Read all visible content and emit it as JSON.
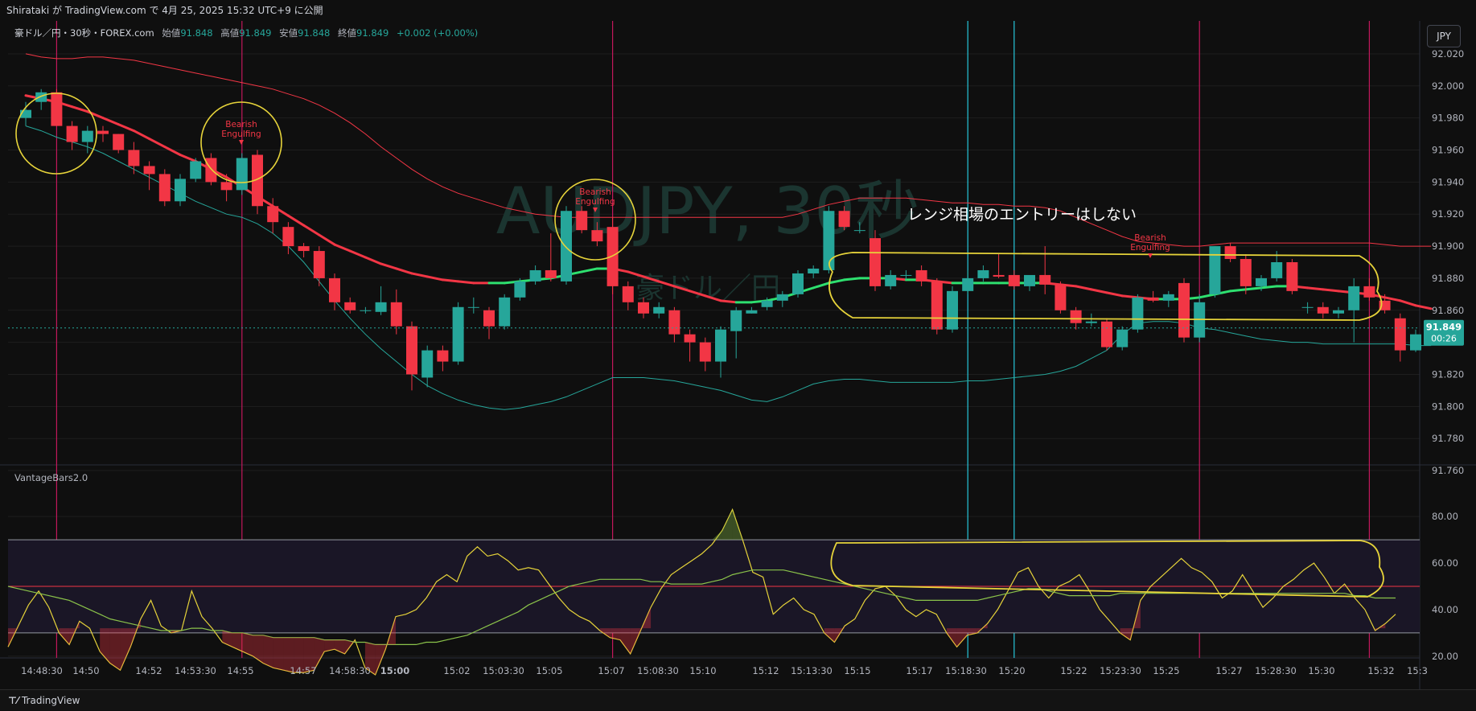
{
  "header": {
    "publish_text": "Shirataki が TradingView.com で 4月 25, 2025 15:32 UTC+9 に公開"
  },
  "legend": {
    "symbol": "豪ドル／円・30秒・FOREX.com",
    "open_label": "始値",
    "open": "91.848",
    "high_label": "高値",
    "high": "91.849",
    "low_label": "安値",
    "low": "91.848",
    "close_label": "終値",
    "close": "91.849",
    "change": "+0.002 (+0.00%)"
  },
  "currency_button": "JPY",
  "watermark": {
    "line1": "AUDJPY, 30秒",
    "line2": "豪ドル／円"
  },
  "annotations": {
    "range_note": "レンジ相場のエントリーはしない",
    "pattern_label_1": "Bearish",
    "pattern_label_2": "Engulfing"
  },
  "price_badge": {
    "price": "91.849",
    "countdown": "00:26"
  },
  "indicator_name": "VantageBars2.0",
  "footer": {
    "brand": "TradingView"
  },
  "colors": {
    "bull": "#26a69a",
    "bear": "#f23645",
    "ma": "#f23645",
    "ma_bull": "#2ee06f",
    "upper_band": "#f23645",
    "lower_band": "#26a69a",
    "vline_red": "#c2185b",
    "vline_cyan": "#26c6da",
    "osc": "#e6d33a",
    "osc_signal": "#8bc34a",
    "circle": "#e6d33a"
  },
  "chart_data": [
    {
      "type": "candlestick",
      "title": "AUDJPY, 30秒",
      "y_axis_ticks": [
        "92.020",
        "92.000",
        "91.980",
        "91.960",
        "91.940",
        "91.920",
        "91.900",
        "91.880",
        "91.860",
        "91.840",
        "91.820",
        "91.800",
        "91.780",
        "91.760"
      ],
      "ylim": [
        91.754,
        92.027
      ],
      "x_axis_ticks": [
        "14:48:30",
        "14:50",
        "14:52",
        "14:53:30",
        "14:55",
        "14:57",
        "14:58:30",
        "15:00",
        "15:02",
        "15:03:30",
        "15:05",
        "15:07",
        "15:08:30",
        "15:10",
        "15:12",
        "15:13:30",
        "15:15",
        "15:17",
        "15:18:30",
        "15:20",
        "15:22",
        "15:23:30",
        "15:25",
        "15:27",
        "15:28:30",
        "15:30",
        "15:32",
        "15:3"
      ],
      "candles": [
        [
          91.98,
          91.99,
          91.975,
          91.985
        ],
        [
          91.99,
          91.998,
          91.985,
          91.996
        ],
        [
          91.996,
          91.998,
          91.975,
          91.975
        ],
        [
          91.975,
          91.978,
          91.96,
          91.965
        ],
        [
          91.965,
          91.975,
          91.958,
          91.972
        ],
        [
          91.972,
          91.975,
          91.965,
          91.97
        ],
        [
          91.97,
          91.97,
          91.958,
          91.96
        ],
        [
          91.96,
          91.965,
          91.945,
          91.95
        ],
        [
          91.95,
          91.953,
          91.935,
          91.945
        ],
        [
          91.945,
          91.948,
          91.925,
          91.928
        ],
        [
          91.928,
          91.945,
          91.925,
          91.942
        ],
        [
          91.942,
          91.955,
          91.94,
          91.953
        ],
        [
          91.955,
          91.958,
          91.938,
          91.94
        ],
        [
          91.94,
          91.945,
          91.928,
          91.935
        ],
        [
          91.935,
          91.958,
          91.932,
          91.955
        ],
        [
          91.957,
          91.96,
          91.92,
          91.925
        ],
        [
          91.925,
          91.93,
          91.908,
          91.915
        ],
        [
          91.912,
          91.915,
          91.895,
          91.9
        ],
        [
          91.9,
          91.902,
          91.893,
          91.897
        ],
        [
          91.897,
          91.9,
          91.875,
          91.88
        ],
        [
          91.88,
          91.883,
          91.86,
          91.865
        ],
        [
          91.865,
          91.868,
          91.858,
          91.86
        ],
        [
          91.86,
          91.862,
          91.858,
          91.86
        ],
        [
          91.859,
          91.875,
          91.857,
          91.865
        ],
        [
          91.865,
          91.873,
          91.845,
          91.85
        ],
        [
          91.85,
          91.853,
          91.81,
          91.82
        ],
        [
          91.818,
          91.838,
          91.812,
          91.835
        ],
        [
          91.835,
          91.838,
          91.822,
          91.828
        ],
        [
          91.828,
          91.865,
          91.826,
          91.862
        ],
        [
          91.862,
          91.868,
          91.858,
          91.862
        ],
        [
          91.86,
          91.862,
          91.842,
          91.85
        ],
        [
          91.85,
          91.87,
          91.848,
          91.868
        ],
        [
          91.868,
          91.88,
          91.866,
          91.878
        ],
        [
          91.878,
          91.888,
          91.876,
          91.885
        ],
        [
          91.885,
          91.908,
          91.878,
          91.88
        ],
        [
          91.878,
          91.925,
          91.876,
          91.922
        ],
        [
          91.922,
          91.925,
          91.908,
          91.91
        ],
        [
          91.91,
          91.915,
          91.9,
          91.903
        ],
        [
          91.912,
          91.918,
          91.87,
          91.875
        ],
        [
          91.875,
          91.878,
          91.86,
          91.865
        ],
        [
          91.865,
          91.868,
          91.855,
          91.858
        ],
        [
          91.858,
          91.865,
          91.855,
          91.862
        ],
        [
          91.86,
          91.862,
          91.84,
          91.845
        ],
        [
          91.845,
          91.848,
          91.828,
          91.84
        ],
        [
          91.84,
          91.843,
          91.822,
          91.828
        ],
        [
          91.828,
          91.85,
          91.818,
          91.848
        ],
        [
          91.847,
          91.862,
          91.83,
          91.86
        ],
        [
          91.858,
          91.862,
          91.858,
          91.86
        ],
        [
          91.862,
          91.868,
          91.86,
          91.866
        ],
        [
          91.866,
          91.872,
          91.862,
          91.87
        ],
        [
          91.87,
          91.885,
          91.868,
          91.883
        ],
        [
          91.883,
          91.888,
          91.88,
          91.886
        ],
        [
          91.885,
          91.925,
          91.883,
          91.922
        ],
        [
          91.922,
          91.925,
          91.91,
          91.912
        ],
        [
          91.91,
          91.915,
          91.908,
          91.91
        ],
        [
          91.905,
          91.91,
          91.872,
          91.875
        ],
        [
          91.875,
          91.885,
          91.873,
          91.882
        ],
        [
          91.882,
          91.885,
          91.879,
          91.882
        ],
        [
          91.885,
          91.888,
          91.875,
          91.878
        ],
        [
          91.878,
          91.88,
          91.845,
          91.848
        ],
        [
          91.848,
          91.875,
          91.846,
          91.872
        ],
        [
          91.872,
          91.885,
          91.87,
          91.88
        ],
        [
          91.88,
          91.888,
          91.878,
          91.885
        ],
        [
          91.882,
          91.895,
          91.88,
          91.881
        ],
        [
          91.882,
          91.885,
          91.873,
          91.875
        ],
        [
          91.875,
          91.88,
          91.872,
          91.882
        ],
        [
          91.882,
          91.9,
          91.87,
          91.876
        ],
        [
          91.876,
          91.878,
          91.858,
          91.86
        ],
        [
          91.86,
          91.862,
          91.848,
          91.852
        ],
        [
          91.852,
          91.858,
          91.85,
          91.853
        ],
        [
          91.853,
          91.855,
          91.835,
          91.837
        ],
        [
          91.837,
          91.85,
          91.835,
          91.848
        ],
        [
          91.848,
          91.87,
          91.846,
          91.868
        ],
        [
          91.868,
          91.872,
          91.865,
          91.866
        ],
        [
          91.866,
          91.872,
          91.862,
          91.87
        ],
        [
          91.877,
          91.88,
          91.84,
          91.843
        ],
        [
          91.843,
          91.87,
          91.84,
          91.865
        ],
        [
          91.87,
          91.9,
          91.868,
          91.9
        ],
        [
          91.9,
          91.902,
          91.89,
          91.892
        ],
        [
          91.892,
          91.895,
          91.87,
          91.875
        ],
        [
          91.875,
          91.882,
          91.872,
          91.88
        ],
        [
          91.88,
          91.897,
          91.878,
          91.89
        ],
        [
          91.89,
          91.892,
          91.87,
          91.872
        ],
        [
          91.862,
          91.865,
          91.858,
          91.862
        ],
        [
          91.862,
          91.865,
          91.855,
          91.858
        ],
        [
          91.858,
          91.862,
          91.855,
          91.86
        ],
        [
          91.86,
          91.88,
          91.84,
          91.875
        ],
        [
          91.875,
          91.88,
          91.866,
          91.868
        ],
        [
          91.866,
          91.87,
          91.858,
          91.86
        ],
        [
          91.855,
          91.858,
          91.828,
          91.835
        ],
        [
          91.835,
          91.848,
          91.834,
          91.845
        ]
      ],
      "ma": [
        91.994,
        91.992,
        91.99,
        91.987,
        91.984,
        91.98,
        91.976,
        91.972,
        91.967,
        91.962,
        91.957,
        91.953,
        91.948,
        91.943,
        91.937,
        91.931,
        91.925,
        91.919,
        91.913,
        91.907,
        91.901,
        91.897,
        91.893,
        91.889,
        91.886,
        91.883,
        91.881,
        91.879,
        91.878,
        91.877,
        91.877,
        91.877,
        91.878,
        91.879,
        91.88,
        91.882,
        91.884,
        91.886,
        91.886,
        91.884,
        91.881,
        91.878,
        91.875,
        91.872,
        91.869,
        91.866,
        91.865,
        91.865,
        91.866,
        91.868,
        91.871,
        91.874,
        91.877,
        91.879,
        91.88,
        91.88,
        91.88,
        91.879,
        91.879,
        91.878,
        91.877,
        91.877,
        91.877,
        91.877,
        91.877,
        91.877,
        91.877,
        91.876,
        91.875,
        91.873,
        91.871,
        91.869,
        91.868,
        91.867,
        91.867,
        91.867,
        91.868,
        91.87,
        91.872,
        91.873,
        91.874,
        91.875,
        91.875,
        91.874,
        91.873,
        91.872,
        91.871,
        91.87,
        91.868,
        91.866,
        91.863,
        91.861
      ],
      "upper_band": [
        92.02,
        92.018,
        92.017,
        92.017,
        92.018,
        92.018,
        92.017,
        92.016,
        92.014,
        92.012,
        92.01,
        92.008,
        92.006,
        92.004,
        92.002,
        92.0,
        91.998,
        91.995,
        91.992,
        91.988,
        91.983,
        91.977,
        91.97,
        91.962,
        91.955,
        91.948,
        91.942,
        91.937,
        91.933,
        91.93,
        91.927,
        91.924,
        91.922,
        91.92,
        91.919,
        91.918,
        91.918,
        91.918,
        91.918,
        91.918,
        91.918,
        91.918,
        91.918,
        91.918,
        91.918,
        91.918,
        91.918,
        91.918,
        91.918,
        91.918,
        91.92,
        91.923,
        91.926,
        91.928,
        91.93,
        91.93,
        91.93,
        91.93,
        91.929,
        91.928,
        91.927,
        91.927,
        91.926,
        91.926,
        91.925,
        91.925,
        91.924,
        91.922,
        91.918,
        91.914,
        91.91,
        91.906,
        91.903,
        91.902,
        91.901,
        91.9,
        91.9,
        91.901,
        91.902,
        91.902,
        91.902,
        91.902,
        91.902,
        91.902,
        91.902,
        91.902,
        91.902,
        91.902,
        91.901,
        91.9,
        91.9,
        91.9
      ],
      "lower_band": [
        91.975,
        91.972,
        91.968,
        91.965,
        91.962,
        91.958,
        91.953,
        91.948,
        91.943,
        91.938,
        91.933,
        91.928,
        91.924,
        91.92,
        91.918,
        91.914,
        91.908,
        91.9,
        91.89,
        91.878,
        91.866,
        91.855,
        91.845,
        91.836,
        91.828,
        91.82,
        91.813,
        91.808,
        91.804,
        91.801,
        91.799,
        91.798,
        91.799,
        91.801,
        91.803,
        91.806,
        91.81,
        91.814,
        91.818,
        91.818,
        91.818,
        91.817,
        91.816,
        91.814,
        91.812,
        91.81,
        91.807,
        91.804,
        91.803,
        91.806,
        91.81,
        91.814,
        91.816,
        91.817,
        91.817,
        91.816,
        91.815,
        91.815,
        91.815,
        91.815,
        91.815,
        91.816,
        91.816,
        91.817,
        91.818,
        91.819,
        91.82,
        91.822,
        91.825,
        91.83,
        91.835,
        91.845,
        91.852,
        91.853,
        91.853,
        91.852,
        91.849,
        91.848,
        91.846,
        91.844,
        91.842,
        91.841,
        91.84,
        91.84,
        91.839,
        91.839,
        91.839,
        91.839,
        91.839,
        91.839,
        91.838,
        91.838
      ],
      "vertical_lines_red_index": [
        2,
        14,
        38,
        76,
        87
      ],
      "vertical_lines_cyan_index": [
        61,
        64
      ]
    },
    {
      "type": "line",
      "title": "VantageBars2.0",
      "y_axis_ticks": [
        "80.00",
        "60.00",
        "40.00",
        "20.00"
      ],
      "ylim": [
        12,
        88
      ],
      "levels": [
        70,
        50,
        30
      ],
      "series": [
        {
          "values": [
            24,
            33,
            42,
            48,
            41,
            30,
            25,
            35,
            32,
            22,
            17,
            14,
            24,
            36,
            44,
            33,
            30,
            31,
            48,
            37,
            32,
            26,
            24,
            22,
            20,
            17,
            15,
            14,
            13,
            13,
            14,
            22,
            23,
            21,
            27,
            15,
            12,
            23,
            37,
            38,
            40,
            45,
            52,
            55,
            52,
            63,
            67,
            63,
            64,
            61,
            57,
            58,
            57,
            51,
            45,
            40,
            37,
            35,
            31,
            28,
            27,
            21,
            31,
            41,
            49,
            55,
            58,
            61,
            64,
            68,
            74,
            83,
            70,
            56,
            54,
            38,
            42,
            45,
            40,
            38,
            30,
            26,
            33,
            36,
            44,
            49,
            50,
            46,
            40,
            37,
            40,
            38,
            30,
            24,
            29,
            30,
            34,
            40,
            48,
            56,
            58,
            50,
            45,
            50,
            52,
            55,
            48,
            40,
            35,
            30,
            27,
            44,
            50,
            54,
            58,
            62,
            58,
            56,
            52,
            45,
            48,
            55,
            48,
            41,
            45,
            50,
            53,
            57,
            60,
            54,
            47,
            51,
            45,
            40,
            31,
            34,
            38
          ]
        },
        {
          "values": [
            50,
            49,
            48,
            47,
            46,
            45,
            44,
            42,
            40,
            38,
            36,
            35,
            34,
            33,
            32,
            31,
            31,
            31,
            32,
            32,
            31,
            31,
            30,
            30,
            29,
            29,
            28,
            28,
            28,
            28,
            28,
            27,
            27,
            27,
            26,
            26,
            25,
            25,
            25,
            25,
            25,
            26,
            26,
            27,
            28,
            29,
            31,
            33,
            35,
            37,
            39,
            42,
            44,
            46,
            48,
            50,
            51,
            52,
            53,
            53,
            53,
            53,
            53,
            52,
            52,
            51,
            51,
            51,
            51,
            52,
            53,
            55,
            56,
            57,
            57,
            57,
            57,
            56,
            55,
            54,
            53,
            52,
            51,
            50,
            49,
            48,
            47,
            46,
            45,
            44,
            44,
            44,
            44,
            44,
            44,
            44,
            45,
            46,
            47,
            48,
            49,
            49,
            48,
            47,
            46,
            46,
            46,
            46,
            46,
            47,
            47,
            47,
            47,
            47,
            47,
            47,
            47,
            47,
            47,
            47,
            47,
            47,
            47,
            47,
            47,
            47,
            47,
            47,
            47,
            47,
            47,
            47,
            46,
            46,
            45,
            45,
            45
          ]
        }
      ]
    }
  ]
}
